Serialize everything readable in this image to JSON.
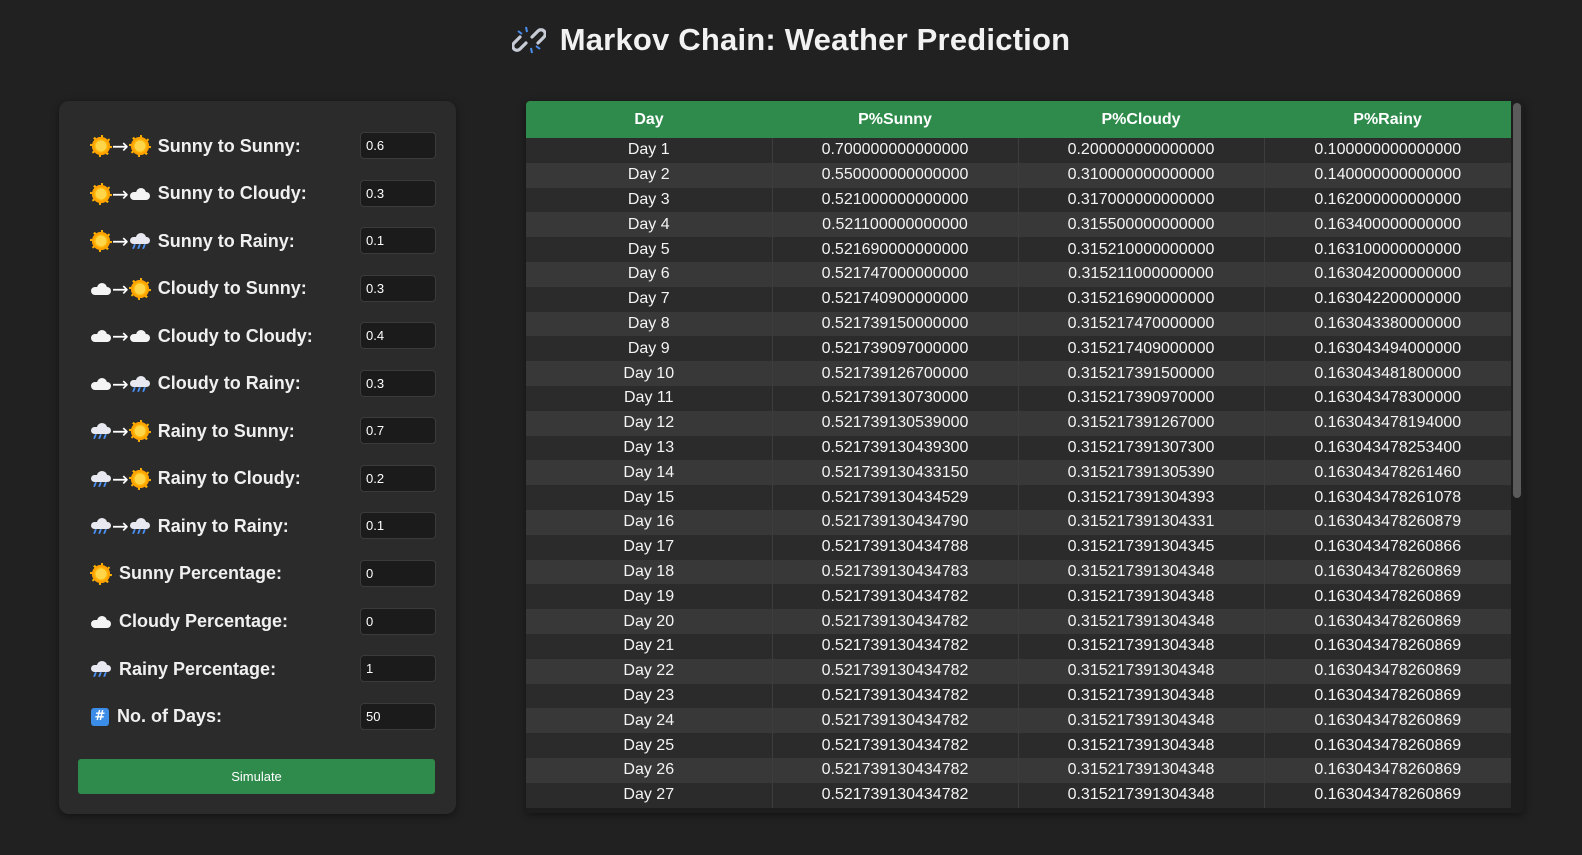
{
  "header": {
    "title": "Markov Chain: Weather Prediction",
    "title_icon": "link-icon"
  },
  "form": {
    "fields": [
      {
        "from": "sun",
        "to": "sun",
        "label": "Sunny to Sunny:",
        "value": "0.6"
      },
      {
        "from": "sun",
        "to": "cloud",
        "label": "Sunny to Cloudy:",
        "value": "0.3"
      },
      {
        "from": "sun",
        "to": "rain",
        "label": "Sunny to Rainy:",
        "value": "0.1"
      },
      {
        "from": "cloud",
        "to": "sun",
        "label": "Cloudy to Sunny:",
        "value": "0.3"
      },
      {
        "from": "cloud",
        "to": "cloud",
        "label": "Cloudy to Cloudy:",
        "value": "0.4"
      },
      {
        "from": "cloud",
        "to": "rain",
        "label": "Cloudy to Rainy:",
        "value": "0.3"
      },
      {
        "from": "rain",
        "to": "sun",
        "label": "Rainy to Sunny:",
        "value": "0.7"
      },
      {
        "from": "rain",
        "to": "sun",
        "label": "Rainy to Cloudy:",
        "value": "0.2"
      },
      {
        "from": "rain",
        "to": "rain",
        "label": "Rainy to Rainy:",
        "value": "0.1"
      },
      {
        "from": "sun",
        "to": null,
        "label": "Sunny Percentage:",
        "value": "0"
      },
      {
        "from": "cloud",
        "to": null,
        "label": "Cloudy Percentage:",
        "value": "0"
      },
      {
        "from": "rain",
        "to": null,
        "label": "Rainy Percentage:",
        "value": "1"
      },
      {
        "from": "hash",
        "to": null,
        "label": "No. of Days:",
        "value": "50"
      }
    ],
    "arrow": "→",
    "hash_glyph": "#",
    "simulate_label": "Simulate"
  },
  "table": {
    "headers": [
      "Day",
      "P%Sunny",
      "P%Cloudy",
      "P%Rainy"
    ],
    "rows": [
      [
        "Day 1",
        "0.700000000000000",
        "0.200000000000000",
        "0.100000000000000"
      ],
      [
        "Day 2",
        "0.550000000000000",
        "0.310000000000000",
        "0.140000000000000"
      ],
      [
        "Day 3",
        "0.521000000000000",
        "0.317000000000000",
        "0.162000000000000"
      ],
      [
        "Day 4",
        "0.521100000000000",
        "0.315500000000000",
        "0.163400000000000"
      ],
      [
        "Day 5",
        "0.521690000000000",
        "0.315210000000000",
        "0.163100000000000"
      ],
      [
        "Day 6",
        "0.521747000000000",
        "0.315211000000000",
        "0.163042000000000"
      ],
      [
        "Day 7",
        "0.521740900000000",
        "0.315216900000000",
        "0.163042200000000"
      ],
      [
        "Day 8",
        "0.521739150000000",
        "0.315217470000000",
        "0.163043380000000"
      ],
      [
        "Day 9",
        "0.521739097000000",
        "0.315217409000000",
        "0.163043494000000"
      ],
      [
        "Day 10",
        "0.521739126700000",
        "0.315217391500000",
        "0.163043481800000"
      ],
      [
        "Day 11",
        "0.521739130730000",
        "0.315217390970000",
        "0.163043478300000"
      ],
      [
        "Day 12",
        "0.521739130539000",
        "0.315217391267000",
        "0.163043478194000"
      ],
      [
        "Day 13",
        "0.521739130439300",
        "0.315217391307300",
        "0.163043478253400"
      ],
      [
        "Day 14",
        "0.521739130433150",
        "0.315217391305390",
        "0.163043478261460"
      ],
      [
        "Day 15",
        "0.521739130434529",
        "0.315217391304393",
        "0.163043478261078"
      ],
      [
        "Day 16",
        "0.521739130434790",
        "0.315217391304331",
        "0.163043478260879"
      ],
      [
        "Day 17",
        "0.521739130434788",
        "0.315217391304345",
        "0.163043478260866"
      ],
      [
        "Day 18",
        "0.521739130434783",
        "0.315217391304348",
        "0.163043478260869"
      ],
      [
        "Day 19",
        "0.521739130434782",
        "0.315217391304348",
        "0.163043478260869"
      ],
      [
        "Day 20",
        "0.521739130434782",
        "0.315217391304348",
        "0.163043478260869"
      ],
      [
        "Day 21",
        "0.521739130434782",
        "0.315217391304348",
        "0.163043478260869"
      ],
      [
        "Day 22",
        "0.521739130434782",
        "0.315217391304348",
        "0.163043478260869"
      ],
      [
        "Day 23",
        "0.521739130434782",
        "0.315217391304348",
        "0.163043478260869"
      ],
      [
        "Day 24",
        "0.521739130434782",
        "0.315217391304348",
        "0.163043478260869"
      ],
      [
        "Day 25",
        "0.521739130434782",
        "0.315217391304348",
        "0.163043478260869"
      ],
      [
        "Day 26",
        "0.521739130434782",
        "0.315217391304348",
        "0.163043478260869"
      ],
      [
        "Day 27",
        "0.521739130434782",
        "0.315217391304348",
        "0.163043478260869"
      ]
    ]
  },
  "colors": {
    "accent": "#2e8b4c",
    "background": "#212121",
    "panel": "#2b2b2b"
  }
}
